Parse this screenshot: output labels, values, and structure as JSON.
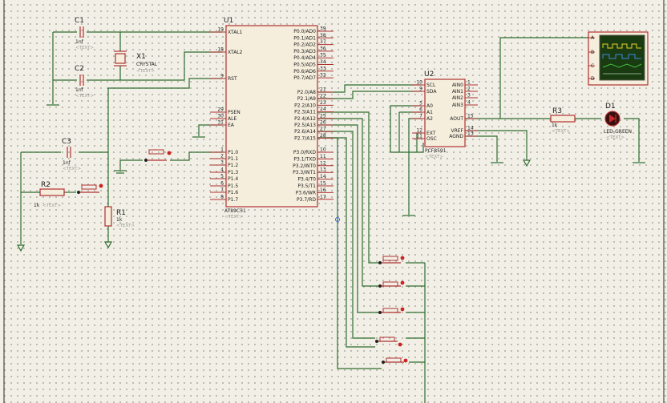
{
  "u1": {
    "ref": "U1",
    "part": "AT89C51",
    "hidden": "<TEXT>",
    "left_pins": [
      {
        "num": "19",
        "name": "XTAL1"
      },
      {
        "num": "18",
        "name": "XTAL2"
      },
      {
        "num": "9",
        "name": "RST"
      },
      {
        "num": "29",
        "name": "PSEN"
      },
      {
        "num": "30",
        "name": "ALE"
      },
      {
        "num": "31",
        "name": "EA"
      },
      {
        "num": "1",
        "name": "P1.0"
      },
      {
        "num": "2",
        "name": "P1.1"
      },
      {
        "num": "3",
        "name": "P1.2"
      },
      {
        "num": "4",
        "name": "P1.3"
      },
      {
        "num": "5",
        "name": "P1.4"
      },
      {
        "num": "6",
        "name": "P1.5"
      },
      {
        "num": "7",
        "name": "P1.6"
      },
      {
        "num": "8",
        "name": "P1.7"
      }
    ],
    "right_pins": [
      {
        "num": "39",
        "name": "P0.0/AD0"
      },
      {
        "num": "38",
        "name": "P0.1/AD1"
      },
      {
        "num": "37",
        "name": "P0.2/AD2"
      },
      {
        "num": "36",
        "name": "P0.3/AD3"
      },
      {
        "num": "35",
        "name": "P0.4/AD4"
      },
      {
        "num": "34",
        "name": "P0.5/AD5"
      },
      {
        "num": "33",
        "name": "P0.6/AD6"
      },
      {
        "num": "32",
        "name": "P0.7/AD7"
      },
      {
        "num": "21",
        "name": "P2.0/A8"
      },
      {
        "num": "22",
        "name": "P2.1/A9"
      },
      {
        "num": "23",
        "name": "P2.2/A10"
      },
      {
        "num": "24",
        "name": "P2.3/A11"
      },
      {
        "num": "25",
        "name": "P2.4/A12"
      },
      {
        "num": "26",
        "name": "P2.5/A13"
      },
      {
        "num": "27",
        "name": "P2.6/A14"
      },
      {
        "num": "28",
        "name": "P2.7/A15"
      },
      {
        "num": "10",
        "name": "P3.0/RXD"
      },
      {
        "num": "11",
        "name": "P3.1/TXD"
      },
      {
        "num": "12",
        "name": "P3.2/INT0"
      },
      {
        "num": "13",
        "name": "P3.3/INT1"
      },
      {
        "num": "14",
        "name": "P3.4/T0"
      },
      {
        "num": "15",
        "name": "P3.5/T1"
      },
      {
        "num": "16",
        "name": "P3.6/WR"
      },
      {
        "num": "17",
        "name": "P3.7/RD"
      }
    ]
  },
  "u2": {
    "ref": "U2",
    "part": "PCF8591",
    "hidden": "<TEXT>",
    "left_pins": [
      {
        "num": "10",
        "name": "SCL"
      },
      {
        "num": "9",
        "name": "SDA"
      },
      {
        "num": "5",
        "name": "A0"
      },
      {
        "num": "6",
        "name": "A1"
      },
      {
        "num": "7",
        "name": "A2"
      },
      {
        "num": "12",
        "name": "EXT"
      },
      {
        "num": "11",
        "name": "OSC"
      }
    ],
    "right_pins": [
      {
        "num": "1",
        "name": "AIN0"
      },
      {
        "num": "2",
        "name": "AIN1"
      },
      {
        "num": "3",
        "name": "AIN2"
      },
      {
        "num": "4",
        "name": "AIN3"
      },
      {
        "num": "15",
        "name": "AOUT"
      },
      {
        "num": "14",
        "name": "VREF"
      },
      {
        "num": "13",
        "name": "AGND"
      }
    ]
  },
  "c1": {
    "ref": "C1",
    "value": "1nf",
    "hidden": "<TEXT>"
  },
  "c2": {
    "ref": "C2",
    "value": "1nf",
    "hidden": "<TEXT>"
  },
  "c3": {
    "ref": "C3",
    "value": "1nf",
    "hidden": "<TEXT>"
  },
  "x1": {
    "ref": "X1",
    "value": "CRYSTAL",
    "hidden": "<TEXT>"
  },
  "r1": {
    "ref": "R1",
    "value": "1k",
    "hidden": "<TEXT>"
  },
  "r2": {
    "ref": "R2",
    "value": "1k",
    "hidden": "<TEXT>"
  },
  "r3": {
    "ref": "R3",
    "value": "1k",
    "hidden": "<TEXT>"
  },
  "d1": {
    "ref": "D1",
    "value": "LED-GREEN",
    "hidden": "<TEXT>"
  },
  "scope": {
    "channels": [
      "A",
      "B",
      "C",
      "D"
    ]
  },
  "colors": {
    "wire": "#2f6b2f",
    "component": "#b03030",
    "chip_fill": "#f5eedd",
    "sheet": "#f2f0e6",
    "scope_screen": "#1a3a12"
  }
}
